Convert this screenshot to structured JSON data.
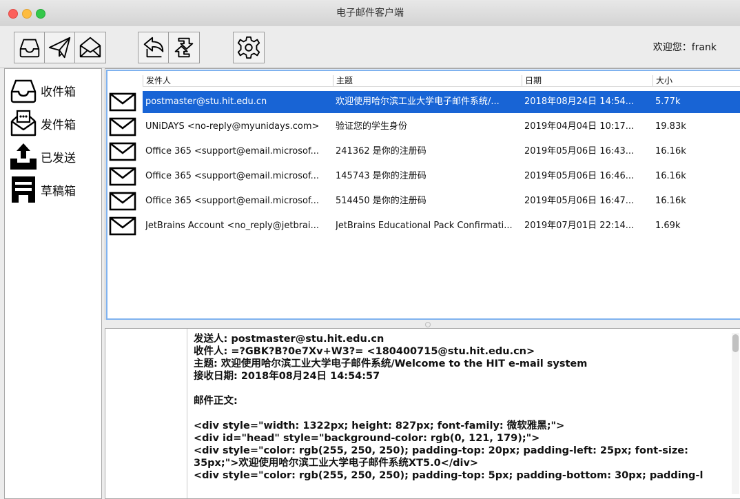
{
  "window": {
    "title": "电子邮件客户端"
  },
  "toolbar": {
    "buttons": [
      "inbox-icon",
      "send-icon",
      "open-mail-icon",
      "reply-icon",
      "refresh-icon",
      "settings-icon"
    ],
    "welcome": "欢迎您：frank"
  },
  "sidebar": {
    "items": [
      {
        "label": "收件箱",
        "icon": "inbox-icon"
      },
      {
        "label": "发件箱",
        "icon": "outbox-icon"
      },
      {
        "label": "已发送",
        "icon": "sent-icon"
      },
      {
        "label": "草稿箱",
        "icon": "drafts-icon"
      }
    ]
  },
  "mail_list": {
    "columns": [
      "发件人",
      "主题",
      "日期",
      "大小"
    ],
    "rows": [
      {
        "from": "postmaster@stu.hit.edu.cn",
        "subject": "欢迎使用哈尔滨工业大学电子邮件系统/...",
        "date": "2018年08月24日 14:54...",
        "size": "5.77k",
        "selected": true
      },
      {
        "from": "UNiDAYS <no-reply@myunidays.com>",
        "subject": "验证您的学生身份",
        "date": "2019年04月04日 10:17...",
        "size": "19.83k"
      },
      {
        "from": "Office 365 <support@email.microsof...",
        "subject": "241362 是你的注册码",
        "date": "2019年05月06日 16:43...",
        "size": "16.16k"
      },
      {
        "from": "Office 365 <support@email.microsof...",
        "subject": "145743 是你的注册码",
        "date": "2019年05月06日 16:46...",
        "size": "16.16k"
      },
      {
        "from": "Office 365 <support@email.microsof...",
        "subject": "514450 是你的注册码",
        "date": "2019年05月06日 16:47...",
        "size": "16.16k"
      },
      {
        "from": "JetBrains Account <no_reply@jetbrai...",
        "subject": "JetBrains Educational Pack Confirmati...",
        "date": "2019年07月01日 22:14...",
        "size": "1.69k"
      }
    ]
  },
  "detail": {
    "from": "发送人:    postmaster@stu.hit.edu.cn",
    "to": "收件人:    =?GBK?B?0e7Xv+W3?=  <180400715@stu.hit.edu.cn>",
    "subject": "主题:    欢迎使用哈尔滨工业大学电子邮件系统/Welcome to the HIT e-mail system",
    "date": "接收日期:    2018年08月24日 14:54:57",
    "body_label": "邮件正文:",
    "body_lines": [
      "<div style=\"width: 1322px; height: 827px; font-family: 微软雅黑;\">",
      "<div id=\"head\" style=\"background-color: rgb(0, 121, 179);\">",
      "<div style=\"color: rgb(255, 250, 250); padding-top: 20px; padding-left: 25px; font-size: 35px;\">欢迎使用哈尔滨工业大学电子邮件系统XT5.0</div>",
      "<div style=\"color: rgb(255, 250, 250); padding-top: 5px; padding-bottom: 30px; padding-l"
    ]
  },
  "colors": {
    "selection": "#1864d5",
    "focus_ring": "#7fb2ef"
  }
}
